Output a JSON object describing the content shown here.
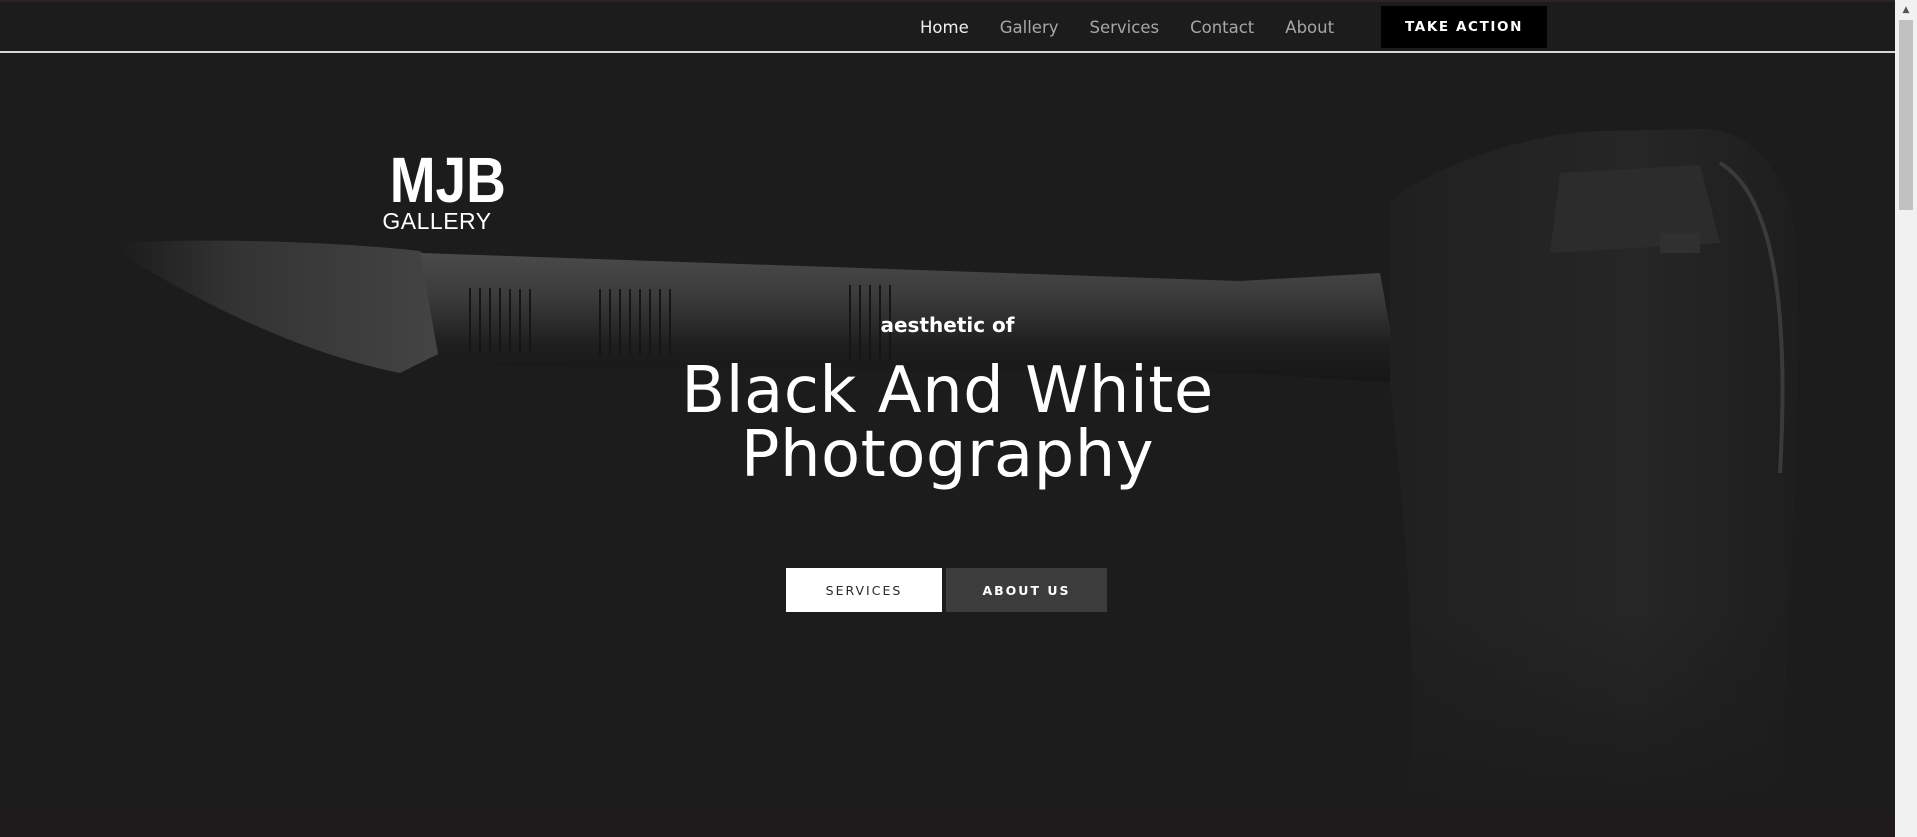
{
  "nav": {
    "links": [
      "Home",
      "Gallery",
      "Services",
      "Contact",
      "About"
    ],
    "active": "Home",
    "cta_label": "TAKE ACTION"
  },
  "logo": {
    "line1": "MJB",
    "line2": "GALLERY"
  },
  "hero": {
    "eyebrow": "aesthetic of",
    "title_line1": "Black And White",
    "title_line2": "Photography",
    "buttons": {
      "services": "SERVICES",
      "about": "ABOUT US"
    },
    "background_image": "camera-with-telephoto-lens"
  },
  "colors": {
    "background": "#1d1c1d",
    "nav_text": "#a7a7a7",
    "active_text": "#f0f0f0",
    "cta_background": "#000000",
    "services_button": "#ffffff",
    "about_button": "#3c3c3c"
  }
}
